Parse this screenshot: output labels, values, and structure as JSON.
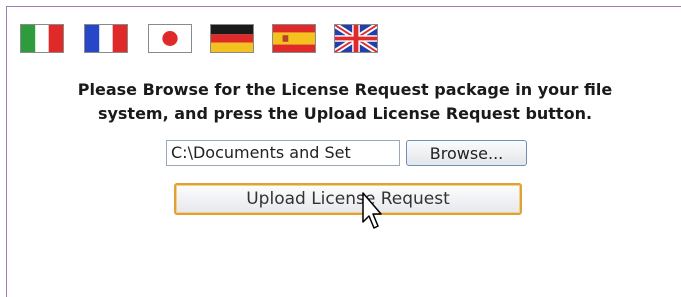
{
  "flags": [
    {
      "name": "italy-flag-icon",
      "colors": [
        "#2e9b3c",
        "#ffffff",
        "#e02a2a"
      ]
    },
    {
      "name": "france-flag-icon",
      "colors": [
        "#2746c8",
        "#ffffff",
        "#e02a2a"
      ]
    },
    {
      "name": "japan-flag-icon",
      "colors": [
        "#ffffff",
        "#e02a2a"
      ]
    },
    {
      "name": "germany-flag-icon",
      "colors": [
        "#1a1a1a",
        "#e02a2a",
        "#f4c21f"
      ]
    },
    {
      "name": "spain-flag-icon",
      "colors": [
        "#e02a2a",
        "#f4c21f",
        "#e02a2a"
      ]
    },
    {
      "name": "uk-flag-icon",
      "colors": [
        "#1f3fae",
        "#ffffff",
        "#e02a2a"
      ]
    }
  ],
  "instructions": {
    "line1": "Please Browse for the License Request package in your file",
    "line2": "system, and press the Upload License Request button."
  },
  "file_input": {
    "value": "C:\\Documents and Set"
  },
  "browse_button": {
    "label": "Browse..."
  },
  "upload_button": {
    "label": "Upload License Request"
  },
  "accent_colors": {
    "focus_border": "#e0a236",
    "panel_border": "#9a7fb6"
  }
}
